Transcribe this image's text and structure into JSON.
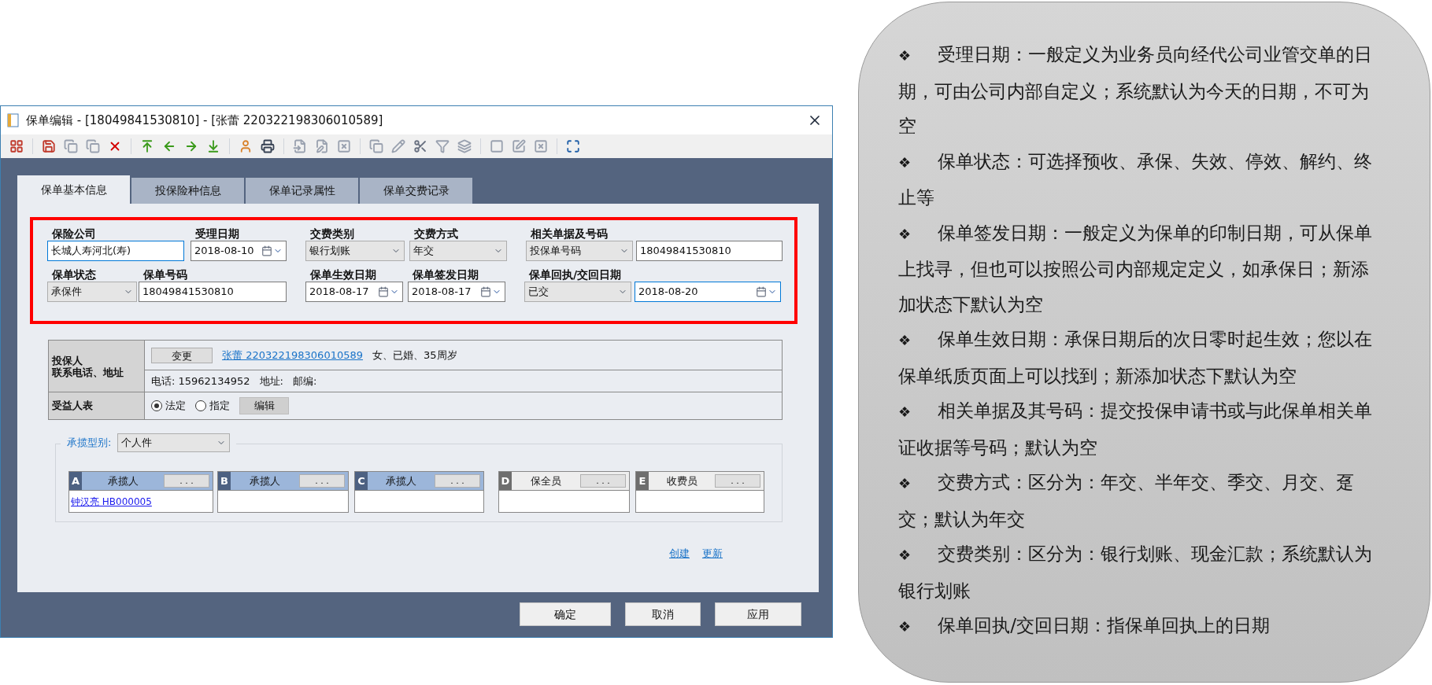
{
  "window": {
    "title": "保单编辑 - [18049841530810] - [张蕾 220322198306010589]"
  },
  "tabs": [
    {
      "label": "保单基本信息",
      "selected": true
    },
    {
      "label": "投保险种信息",
      "selected": false
    },
    {
      "label": "保单记录属性",
      "selected": false
    },
    {
      "label": "保单交费记录",
      "selected": false
    }
  ],
  "form": {
    "rows": [
      [
        {
          "kind": "text",
          "label": "保险公司",
          "value": "长城人寿河北(寿)",
          "focused": true
        },
        {
          "kind": "date",
          "label": "受理日期",
          "value": "2018-08-10",
          "focused": false
        },
        {
          "kind": "select",
          "label": "交费类别",
          "value": "银行划账"
        },
        {
          "kind": "select",
          "label": "交费方式",
          "value": "年交"
        },
        {
          "kind": "select_text",
          "label": "相关单据及号码",
          "value": "投保单号码",
          "text": "18049841530810",
          "focused": false
        }
      ],
      [
        {
          "kind": "select",
          "label": "保单状态",
          "value": "承保件"
        },
        {
          "kind": "text",
          "label": "保单号码",
          "value": "18049841530810",
          "focused": false
        },
        {
          "kind": "date",
          "label": "保单生效日期",
          "value": "2018-08-17",
          "focused": false
        },
        {
          "kind": "date",
          "label": "保单签发日期",
          "value": "2018-08-17",
          "focused": false
        },
        {
          "kind": "select_date",
          "label": "保单回执/交回日期",
          "value": "已交",
          "text": "2018-08-20",
          "focused": true
        }
      ]
    ]
  },
  "applicant": {
    "label_lines": [
      "投保人",
      "联系电话、地址"
    ],
    "change_button": "变更",
    "name_link": "张蕾 220322198306010589",
    "details": "女、已婚、35周岁",
    "phone": "电话: 15962134952",
    "address": "地址:",
    "postcode": "邮编:"
  },
  "beneficiary": {
    "label": "受益人表",
    "options": [
      {
        "label": "法定",
        "selected": true
      },
      {
        "label": "指定",
        "selected": false
      }
    ],
    "edit_button": "编辑"
  },
  "agents": {
    "type_label": "承揽型别:",
    "type_value": "个人件",
    "slots": [
      {
        "letter": "A",
        "label": "承揽人",
        "button": ". . .",
        "kind": "agent",
        "value": "钟汉亮 HB000005"
      },
      {
        "letter": "B",
        "label": "承揽人",
        "button": ". . .",
        "kind": "agent"
      },
      {
        "letter": "C",
        "label": "承揽人",
        "button": ". . .",
        "kind": "agent"
      },
      {
        "letter": "D",
        "label": "保全员",
        "button": ". . .",
        "kind": "staff"
      },
      {
        "letter": "E",
        "label": "收费员",
        "button": ". . .",
        "kind": "staff"
      }
    ]
  },
  "links": [
    "创建",
    "更新"
  ],
  "buttons": [
    "确定",
    "取消",
    "应用"
  ],
  "notes": [
    {
      "bullet": "❖",
      "text": "受理日期：一般定义为业务员向经代公司业管交单的日期，可由公司内部自定义；系统默认为今天的日期，不可为空"
    },
    {
      "bullet": "❖",
      "text": "保单状态：可选择预收、承保、失效、停效、解约、终止等"
    },
    {
      "bullet": "❖",
      "text": "保单签发日期：一般定义为保单的印制日期，可从保单上找寻，但也可以按照公司内部规定定义，如承保日；新添加状态下默认为空"
    },
    {
      "bullet": "❖",
      "text": "保单生效日期：承保日期后的次日零时起生效；您以在保单纸质页面上可以找到；新添加状态下默认为空"
    },
    {
      "bullet": "❖",
      "text": "相关单据及其号码：提交投保申请书或与此保单相关单证收据等号码；默认为空"
    },
    {
      "bullet": "❖",
      "text": "交费方式：区分为：年交、半年交、季交、月交、趸交；默认为年交"
    },
    {
      "bullet": "❖",
      "text": "交费类别：区分为：银行划账、现金汇款；系统默认为银行划账"
    },
    {
      "bullet": "❖",
      "text": "保单回执/交回日期：指保单回执上的日期"
    }
  ]
}
